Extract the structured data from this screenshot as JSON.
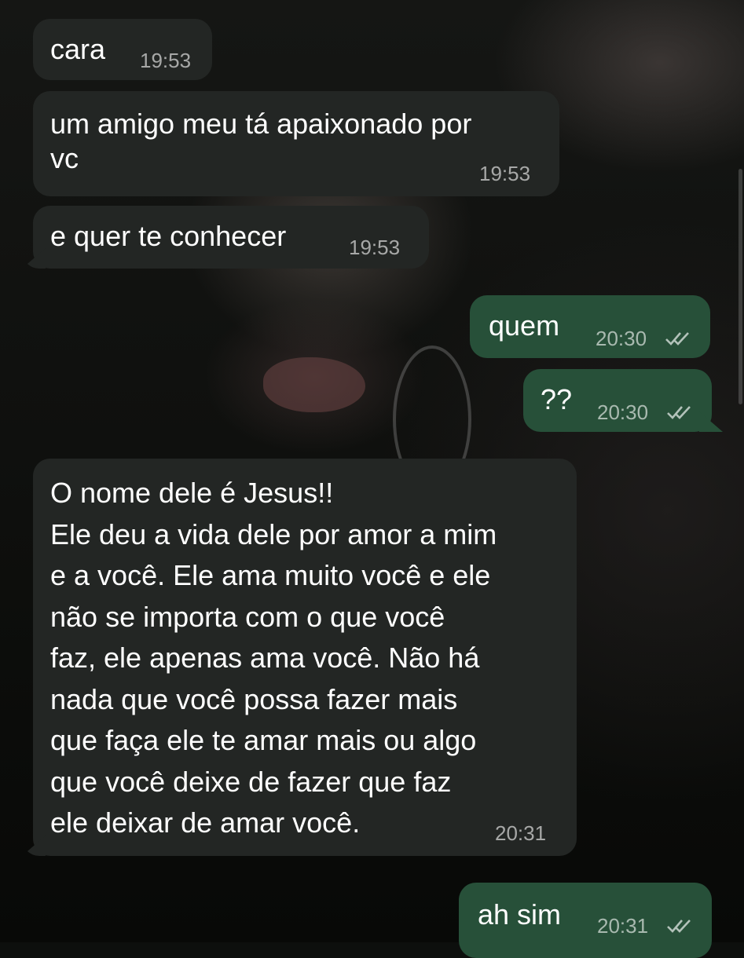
{
  "chat": {
    "messages": [
      {
        "direction": "incoming",
        "text": "cara",
        "time": "19:53"
      },
      {
        "direction": "incoming",
        "text": "um amigo meu tá apaixonado por\nvc",
        "time": "19:53"
      },
      {
        "direction": "incoming",
        "text": "e quer te conhecer",
        "time": "19:53"
      },
      {
        "direction": "outgoing",
        "text": "quem",
        "time": "20:30",
        "status": "read",
        "status_icon": "double-check-icon"
      },
      {
        "direction": "outgoing",
        "text": "??",
        "time": "20:30",
        "status": "read",
        "status_icon": "double-check-icon"
      },
      {
        "direction": "incoming",
        "text": "O nome dele é Jesus!!\nEle deu a vida dele por amor a mim\ne a você. Ele ama muito você e ele\nnão se importa com o que você\nfaz, ele apenas ama você. Não há\nnada que você possa fazer mais\nque faça ele te amar mais ou algo\nque você deixe de fazer que faz\nele deixar de amar você.",
        "time": "20:31"
      },
      {
        "direction": "outgoing",
        "text": "ah sim",
        "time": "20:31",
        "status": "read",
        "status_icon": "double-check-icon"
      }
    ]
  },
  "colors": {
    "incoming_bubble": "#232624",
    "outgoing_bubble": "#275039",
    "text": "#ffffff",
    "timestamp": "#9a9c9a"
  }
}
